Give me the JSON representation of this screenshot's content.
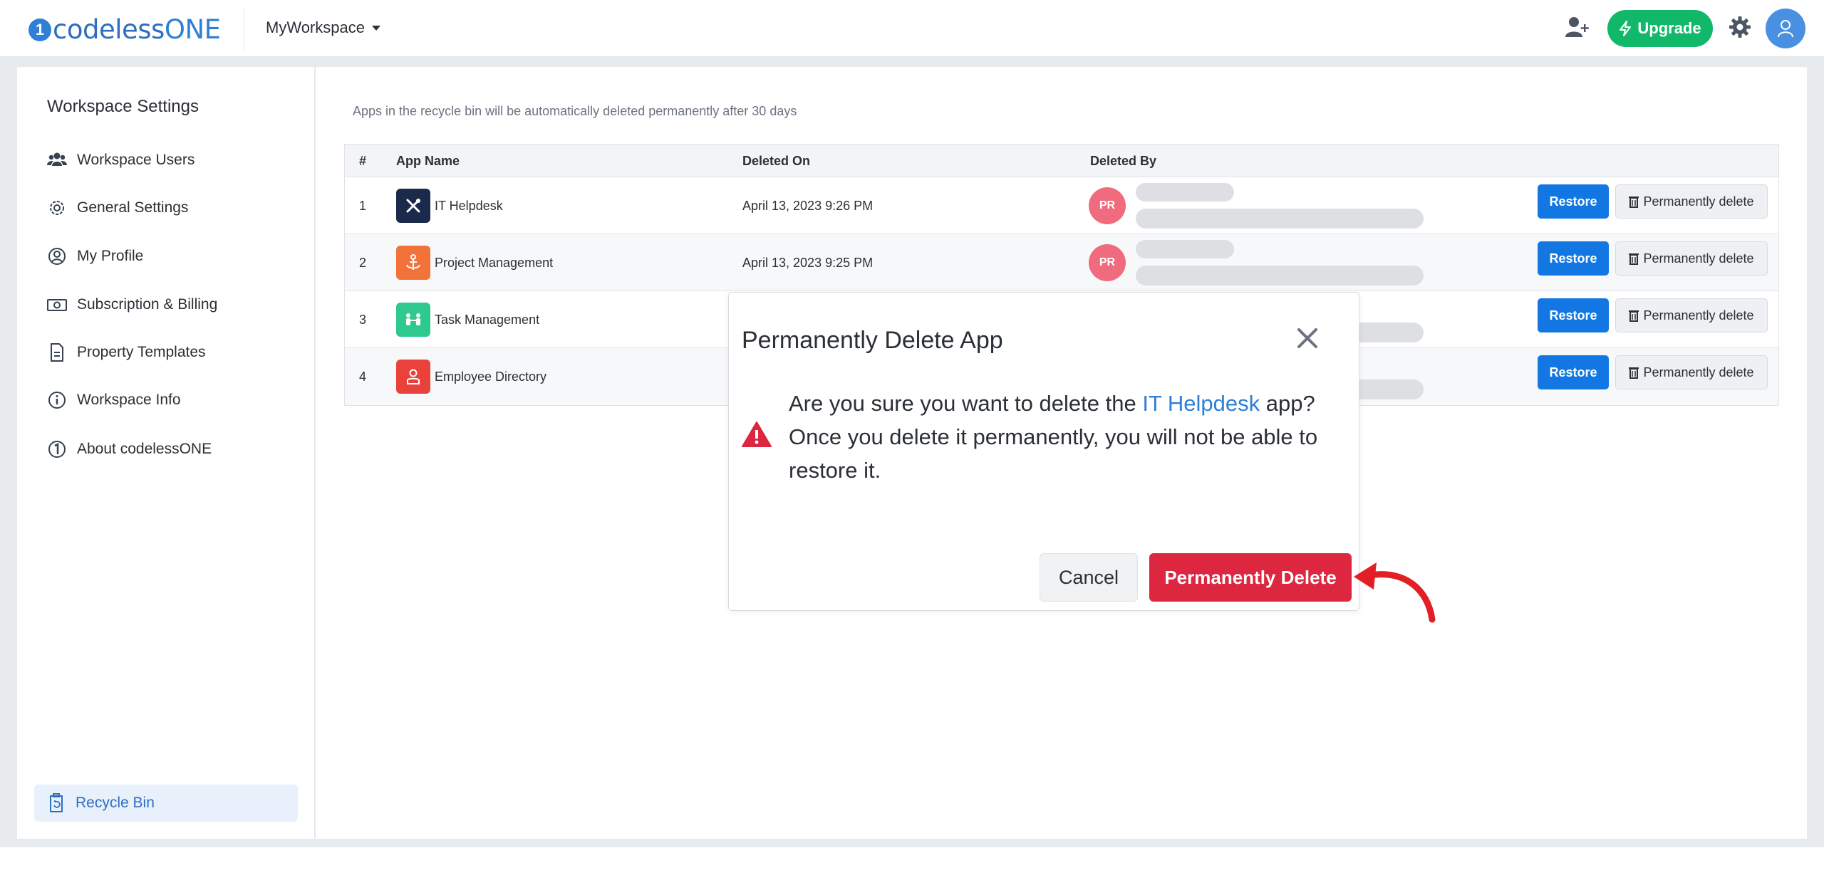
{
  "header": {
    "logo_mark": "1",
    "logo_text_a": "codeless",
    "logo_text_b": "ONE",
    "workspace_name": "MyWorkspace",
    "upgrade_label": "Upgrade"
  },
  "sidebar": {
    "title": "Workspace Settings",
    "items": [
      {
        "label": "Workspace Users",
        "icon": "users-icon"
      },
      {
        "label": "General Settings",
        "icon": "gear-icon"
      },
      {
        "label": "My Profile",
        "icon": "user-circle-icon"
      },
      {
        "label": "Subscription & Billing",
        "icon": "money-icon"
      },
      {
        "label": "Property Templates",
        "icon": "document-icon"
      },
      {
        "label": "Workspace Info",
        "icon": "info-icon"
      },
      {
        "label": "About codelessONE",
        "icon": "codeless-logo-icon"
      }
    ],
    "active": {
      "label": "Recycle Bin",
      "icon": "recycle-bin-icon"
    }
  },
  "main": {
    "notice": "Apps in the recycle bin will be automatically deleted permanently after 30 days",
    "columns": [
      "#",
      "App Name",
      "Deleted On",
      "Deleted By"
    ],
    "restore_label": "Restore",
    "perm_delete_label": "Permanently delete",
    "rows": [
      {
        "num": "1",
        "name": "IT Helpdesk",
        "deleted_on": "April 13, 2023 9:26 PM",
        "by_initials": "PR",
        "icon_color": "#1b2a4a",
        "icon": "tools-icon"
      },
      {
        "num": "2",
        "name": "Project Management",
        "deleted_on": "April 13, 2023 9:25 PM",
        "by_initials": "PR",
        "icon_color": "#f2733a",
        "icon": "anchor-icon"
      },
      {
        "num": "3",
        "name": "Task Management",
        "deleted_on": "",
        "by_initials": "",
        "icon_color": "#2fc98f",
        "icon": "team-icon"
      },
      {
        "num": "4",
        "name": "Employee Directory",
        "deleted_on": "",
        "by_initials": "",
        "icon_color": "#e8423a",
        "icon": "person-icon"
      }
    ]
  },
  "modal": {
    "title": "Permanently Delete App",
    "body_prefix": "Are you sure you want to delete the ",
    "app_name": "IT Helpdesk",
    "body_suffix": " app? Once you delete it permanently, you will not be able to restore it.",
    "cancel_label": "Cancel",
    "delete_label": "Permanently Delete"
  },
  "colors": {
    "accent": "#1277e3",
    "danger": "#dd2640",
    "upgrade": "#12b86a"
  }
}
